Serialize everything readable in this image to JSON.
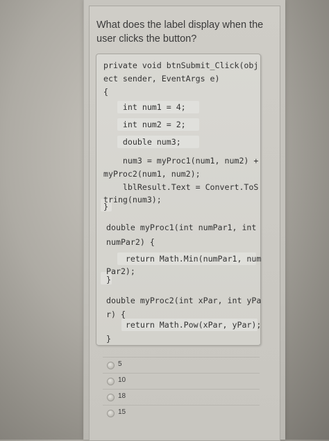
{
  "question": {
    "text": "What does the label display when the user clicks the button?"
  },
  "code": {
    "lines": [
      "private void btnSubmit_Click(obj",
      "ect sender, EventArgs e)",
      "{",
      "    int num1 = 4;",
      "    int num2 = 2;",
      "    double num3;",
      "",
      "    num3 = myProc1(num1, num2) +",
      "myProc2(num1, num2);",
      "    lblResult.Text = Convert.ToS",
      "tring(num3);",
      "}",
      "",
      "double myProc1(int numPar1, int",
      "numPar2) {",
      "    return Math.Min(numPar1, num",
      "Par2);",
      "}",
      "",
      "double myProc2(int xPar, int yPa",
      "r) {",
      "    return Math.Pow(xPar, yPar);",
      "",
      "}"
    ]
  },
  "answers": {
    "options": [
      "5",
      "10",
      "18",
      "15"
    ]
  }
}
